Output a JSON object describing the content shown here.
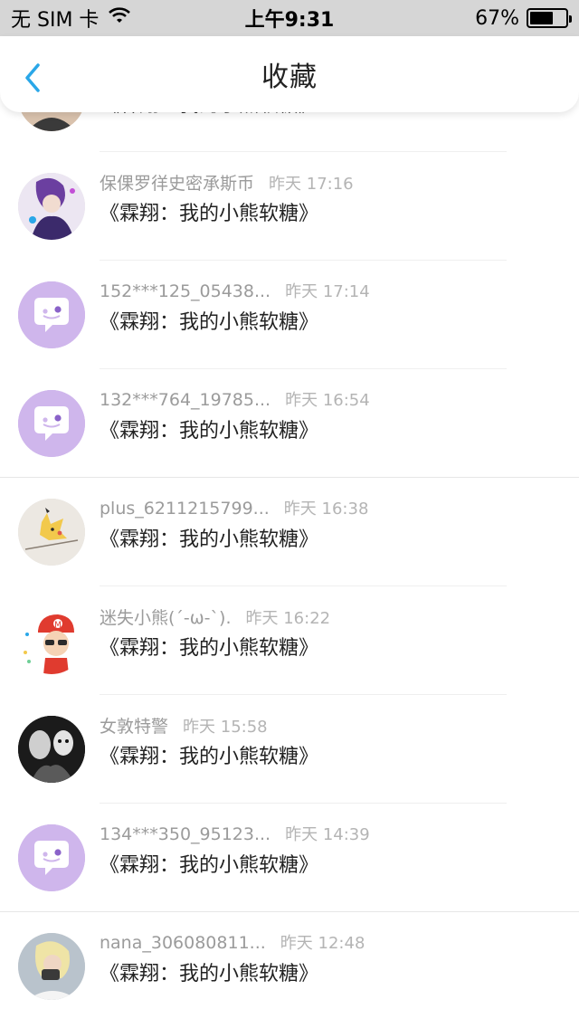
{
  "status_bar": {
    "carrier": "无 SIM 卡",
    "time": "上午9:31",
    "battery": "67%",
    "battery_level": 0.67
  },
  "nav": {
    "title": "收藏"
  },
  "items": [
    {
      "name": "",
      "time": "",
      "title": "《霖翔：我的小熊软糖》",
      "avatar": "photo-avatar"
    },
    {
      "name": "保倮罗徉史密承斯币",
      "time": "昨天 17:16",
      "title": "《霖翔：我的小熊软糖》",
      "avatar": "anime-avatar"
    },
    {
      "name": "152***125_05438...",
      "time": "昨天 17:14",
      "title": "《霖翔：我的小熊软糖》",
      "avatar": "default-chat-avatar"
    },
    {
      "name": "132***764_19785...",
      "time": "昨天 16:54",
      "title": "《霖翔：我的小熊软糖》",
      "avatar": "default-chat-avatar"
    },
    {
      "name": "plus_6211215799...",
      "time": "昨天 16:38",
      "title": "《霖翔：我的小熊软糖》",
      "avatar": "pikachu-avatar"
    },
    {
      "name": "迷失小熊(´-ω-`).",
      "time": "昨天 16:22",
      "title": "《霖翔：我的小熊软糖》",
      "avatar": "cartoon-avatar"
    },
    {
      "name": "女敦特警",
      "time": "昨天 15:58",
      "title": "《霖翔：我的小熊软糖》",
      "avatar": "bw-photo-avatar"
    },
    {
      "name": "134***350_95123...",
      "time": "昨天 14:39",
      "title": "《霖翔：我的小熊软糖》",
      "avatar": "default-chat-avatar"
    },
    {
      "name": "nana_306080811...",
      "time": "昨天 12:48",
      "title": "《霖翔：我的小熊软糖》",
      "avatar": "photo-avatar"
    }
  ],
  "colors": {
    "accent": "#2aa7e8",
    "default_avatar": "#cfb6ec"
  }
}
